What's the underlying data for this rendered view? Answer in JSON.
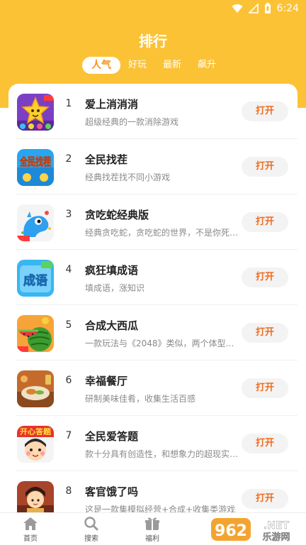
{
  "status": {
    "time": "6:24"
  },
  "page_title": "排行",
  "tabs": [
    {
      "label": "人气",
      "active": true
    },
    {
      "label": "好玩",
      "active": false
    },
    {
      "label": "最新",
      "active": false
    },
    {
      "label": "飙升",
      "active": false
    }
  ],
  "items": [
    {
      "rank": "1",
      "name": "爱上消消消",
      "desc": "超级经典的一款消除游戏",
      "button": "打开"
    },
    {
      "rank": "2",
      "name": "全民找茬",
      "desc": "经典找茬找不同小游戏",
      "button": "打开"
    },
    {
      "rank": "3",
      "name": "贪吃蛇经典版",
      "desc": "经典贪吃蛇，贪吃蛇的世界，不是你死…",
      "button": "打开"
    },
    {
      "rank": "4",
      "name": "疯狂填成语",
      "desc": "填成语，涨知识",
      "button": "打开"
    },
    {
      "rank": "5",
      "name": "合成大西瓜",
      "desc": "一款玩法与《2048》类似，两个体型较…",
      "button": "打开"
    },
    {
      "rank": "6",
      "name": "幸福餐厅",
      "desc": "研制美味佳肴，收集生活百感",
      "button": "打开"
    },
    {
      "rank": "7",
      "name": "全民爱答题",
      "desc": "款十分具有创造性，和想象力的超现实…",
      "button": "打开"
    },
    {
      "rank": "8",
      "name": "客官饿了吗",
      "desc": "这是一款集模拟经营+合成+收集类游戏",
      "button": "打开"
    }
  ],
  "icon_texts": {
    "icon2": "全民找茬",
    "icon4": "成语",
    "icon7": "开心答题"
  },
  "bottom_nav": [
    {
      "label": "首页",
      "icon": "home-icon"
    },
    {
      "label": "搜索",
      "icon": "search-icon"
    },
    {
      "label": "福利",
      "icon": "gift-icon"
    }
  ],
  "watermark": {
    "text": "962",
    "suffix": ".NET",
    "sub": "乐游网"
  },
  "colors": {
    "header": "#fcc235",
    "accent": "#f26b1d",
    "tab_active_text": "#f7941d"
  }
}
